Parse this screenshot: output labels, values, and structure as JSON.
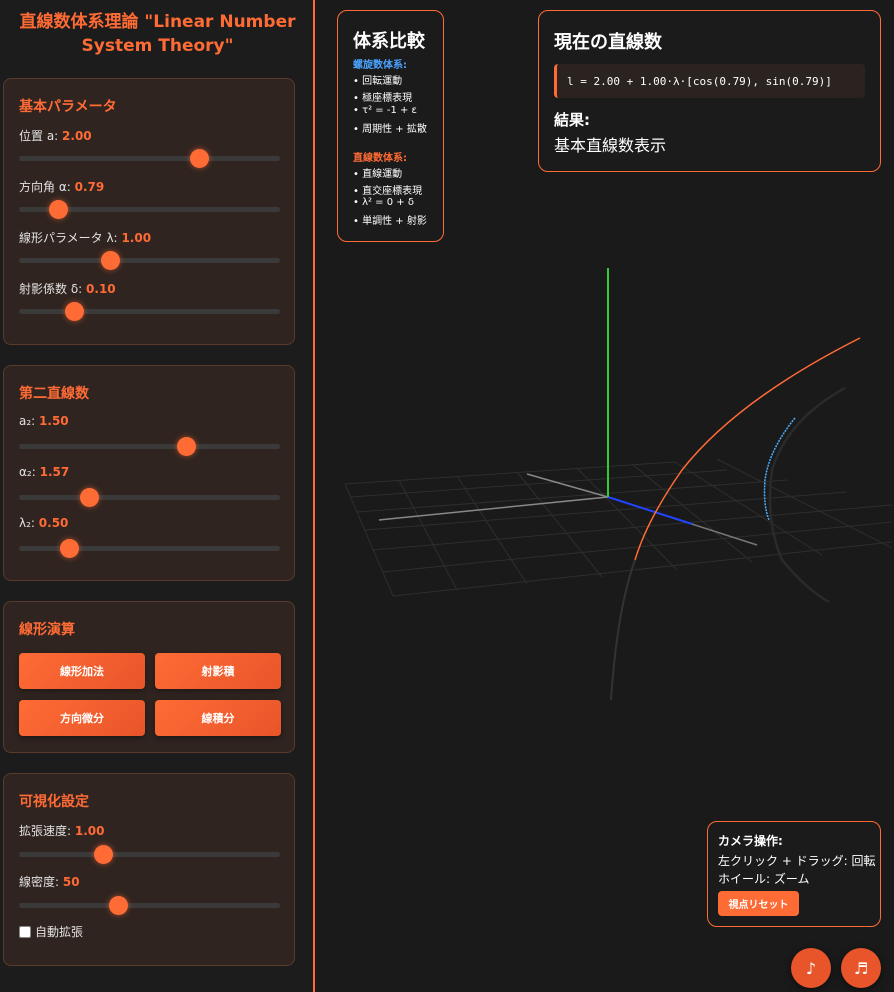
{
  "app": {
    "title_line1": "直線数体系理論 \"Linear Number",
    "title_line2": "System Theory\""
  },
  "basic": {
    "title": "基本パラメータ",
    "params": [
      {
        "label": "位置 a:",
        "value": "2.00",
        "fraction": 0.69
      },
      {
        "label": "方向角 α:",
        "value": "0.79",
        "fraction": 0.15
      },
      {
        "label": "線形パラメータ λ:",
        "value": "1.00",
        "fraction": 0.35
      },
      {
        "label": "射影係数 δ:",
        "value": "0.10",
        "fraction": 0.21
      }
    ]
  },
  "second": {
    "title": "第二直線数",
    "params": [
      {
        "label": "a₂:",
        "value": "1.50",
        "fraction": 0.64
      },
      {
        "label": "α₂:",
        "value": "1.57",
        "fraction": 0.27
      },
      {
        "label": "λ₂:",
        "value": "0.50",
        "fraction": 0.19
      }
    ]
  },
  "ops": {
    "title": "線形演算",
    "buttons": [
      "線形加法",
      "射影積",
      "方向微分",
      "線積分"
    ]
  },
  "viz": {
    "title": "可視化設定",
    "params": [
      {
        "label": "拡張速度:",
        "value": "1.00",
        "fraction": 0.32
      },
      {
        "label": "線密度:",
        "value": "50",
        "fraction": 0.38
      }
    ],
    "checkbox_label": "自動拡張"
  },
  "comparison": {
    "title": "体系比較",
    "spiral_head": "螺旋数体系:",
    "spiral_items": [
      "• 回転運動",
      "• 極座標表現",
      "• τ² = -1 + ε",
      "• 周期性 + 拡散"
    ],
    "linear_head": "直線数体系:",
    "linear_items": [
      "• 直線運動",
      "• 直交座標表現",
      "• λ² = 0 + δ",
      "• 単調性 + 射影"
    ]
  },
  "current": {
    "title": "現在の直線数",
    "formula": "l = 2.00 + 1.00·λ·[cos(0.79), sin(0.79)]",
    "result_label": "結果:",
    "result_value": "基本直線数表示"
  },
  "camera": {
    "title": "カメラ操作:",
    "line1": "左クリック + ドラッグ: 回転",
    "line2": "ホイール: ズーム",
    "reset_label": "視点リセット"
  },
  "audio": {
    "btn1": "♪",
    "btn2": "♬"
  },
  "colors": {
    "accent": "#ff6b35",
    "spiral_head": "#4aa3ff",
    "y_axis": "#33cc33",
    "z_axis": "#2244ff",
    "curve_orange": "#ff6b35",
    "curve_blue": "#4ab0ff"
  }
}
